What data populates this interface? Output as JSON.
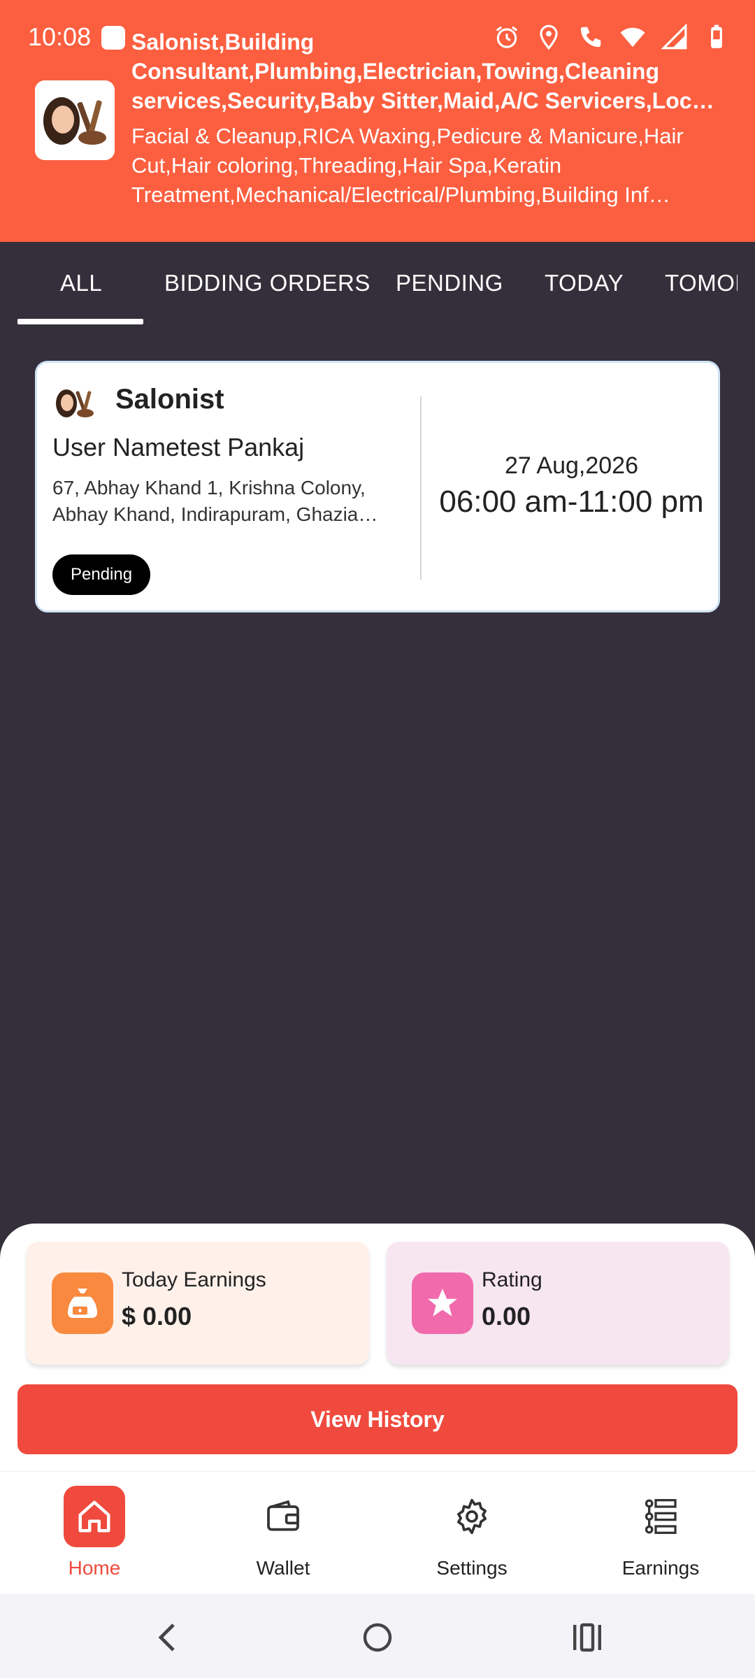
{
  "status_bar": {
    "time": "10:08"
  },
  "header": {
    "categories_line1": "Salonist,Building",
    "categories_line2": "Consultant,Plumbing,Electrician,Towing,Cleaning",
    "categories_line3": "services,Security,Baby Sitter,Maid,A/C Servicers,Lock …",
    "services_line1": "Facial & Cleanup,RICA Waxing,Pedicure & Manicure,Hair",
    "services_line2": "Cut,Hair coloring,Threading,Hair Spa,Keratin",
    "services_line3": "Treatment,Mechanical/Electrical/Plumbing,Building Inf…",
    "logo_icon": "salon-tools-logo"
  },
  "tabs": [
    {
      "label": "ALL",
      "active": true
    },
    {
      "label": "BIDDING ORDERS",
      "active": false
    },
    {
      "label": "PENDING",
      "active": false
    },
    {
      "label": "TODAY",
      "active": false
    },
    {
      "label": "TOMORROW",
      "active": false
    }
  ],
  "order_card": {
    "title": "Salonist",
    "user": "User Nametest Pankaj",
    "address_line1": "67, Abhay Khand 1, Krishna Colony,",
    "address_line2": "Abhay Khand, Indirapuram, Ghazia…",
    "status": "Pending",
    "date": "27 Aug,2026",
    "time_range": "06:00 am-11:00 pm"
  },
  "stats": {
    "earnings_label": "Today Earnings",
    "earnings_value": "$ 0.00",
    "rating_label": "Rating",
    "rating_value": "0.00"
  },
  "history_button": "View History",
  "bottom_nav": [
    {
      "label": "Home",
      "icon": "home-icon",
      "active": true
    },
    {
      "label": "Wallet",
      "icon": "wallet-icon",
      "active": false
    },
    {
      "label": "Settings",
      "icon": "gear-icon",
      "active": false
    },
    {
      "label": "Earnings",
      "icon": "list-tree-icon",
      "active": false
    }
  ],
  "colors": {
    "header": "#fb5f40",
    "background": "#342f3b",
    "accent": "#ef4a3d",
    "earnings_icon": "#f8893f",
    "rating_icon": "#f06aac"
  }
}
